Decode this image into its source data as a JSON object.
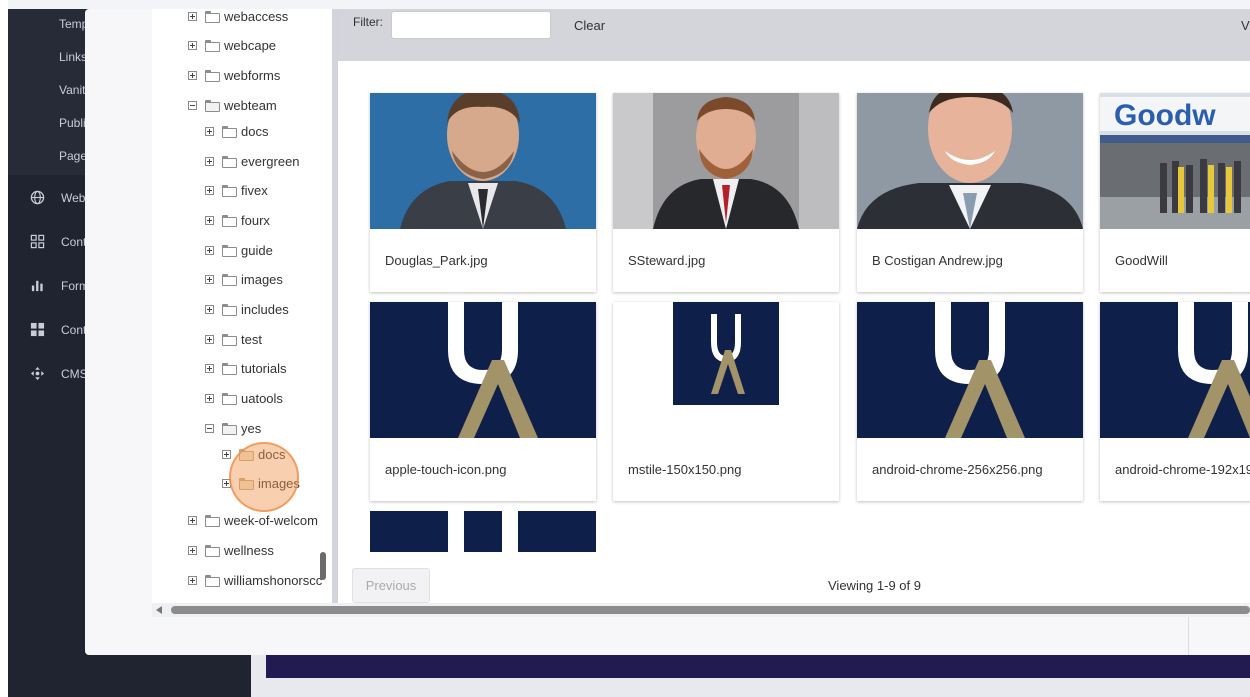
{
  "background": {
    "sidebar_sub_items": [
      "Temp",
      "Links",
      "Vanit",
      "Publi",
      "Page"
    ],
    "sidebar_main_items": [
      {
        "label": "Webs",
        "icon": "globe-icon"
      },
      {
        "label": "Cont",
        "icon": "grid-icon"
      },
      {
        "label": "Form",
        "icon": "bar-chart-icon"
      },
      {
        "label": "Cont",
        "icon": "layout-icon"
      },
      {
        "label": "CMS",
        "icon": "move-icon"
      }
    ]
  },
  "tree": {
    "items": [
      {
        "label": "webaccess",
        "expander": "plus",
        "level": 0
      },
      {
        "label": "webcape",
        "expander": "plus",
        "level": 0
      },
      {
        "label": "webforms",
        "expander": "plus",
        "level": 0
      },
      {
        "label": "webteam",
        "expander": "minus",
        "level": 0,
        "open": true
      },
      {
        "label": "docs",
        "expander": "plus",
        "level": 1
      },
      {
        "label": "evergreen",
        "expander": "plus",
        "level": 1
      },
      {
        "label": "fivex",
        "expander": "plus",
        "level": 1
      },
      {
        "label": "fourx",
        "expander": "plus",
        "level": 1
      },
      {
        "label": "guide",
        "expander": "plus",
        "level": 1
      },
      {
        "label": "images",
        "expander": "plus",
        "level": 1
      },
      {
        "label": "includes",
        "expander": "plus",
        "level": 1
      },
      {
        "label": "test",
        "expander": "plus",
        "level": 1
      },
      {
        "label": "tutorials",
        "expander": "plus",
        "level": 1
      },
      {
        "label": "uatools",
        "expander": "plus",
        "level": 1
      },
      {
        "label": "yes",
        "expander": "minus",
        "level": 1,
        "open": true
      },
      {
        "label": "docs",
        "expander": "plus",
        "level": 2
      },
      {
        "label": "images",
        "expander": "plus",
        "level": 2
      },
      {
        "label": "week-of-welcom",
        "expander": "plus",
        "level": 0
      },
      {
        "label": "wellness",
        "expander": "plus",
        "level": 0
      },
      {
        "label": "williamshonorscc",
        "expander": "plus",
        "level": 0
      }
    ]
  },
  "filter": {
    "label": "Filter:",
    "value": "",
    "placeholder": "",
    "clear_label": "Clear",
    "right_label": "V"
  },
  "gallery": {
    "cards": [
      {
        "name": "Douglas_Park.jpg",
        "thumb": "person-photo"
      },
      {
        "name": "SSteward.jpg",
        "thumb": "person-photo"
      },
      {
        "name": "B Costigan Andrew.jpg",
        "thumb": "person-photo"
      },
      {
        "name": "GoodWill",
        "thumb": "storefront-photo",
        "sign_text": "Goodw"
      },
      {
        "name": "apple-touch-icon.png",
        "thumb": "ua-logo",
        "logo": "UA"
      },
      {
        "name": "mstile-150x150.png",
        "thumb": "ua-logo",
        "logo": "UA"
      },
      {
        "name": "android-chrome-256x256.png",
        "thumb": "ua-logo",
        "logo": "UA"
      },
      {
        "name": "android-chrome-192x192.png",
        "thumb": "ua-logo",
        "logo": "UA"
      }
    ],
    "colors": {
      "navy": "#0e1f4a",
      "gold": "#a39368"
    }
  },
  "pager": {
    "previous_label": "Previous",
    "viewing_text": "Viewing 1-9 of 9"
  }
}
